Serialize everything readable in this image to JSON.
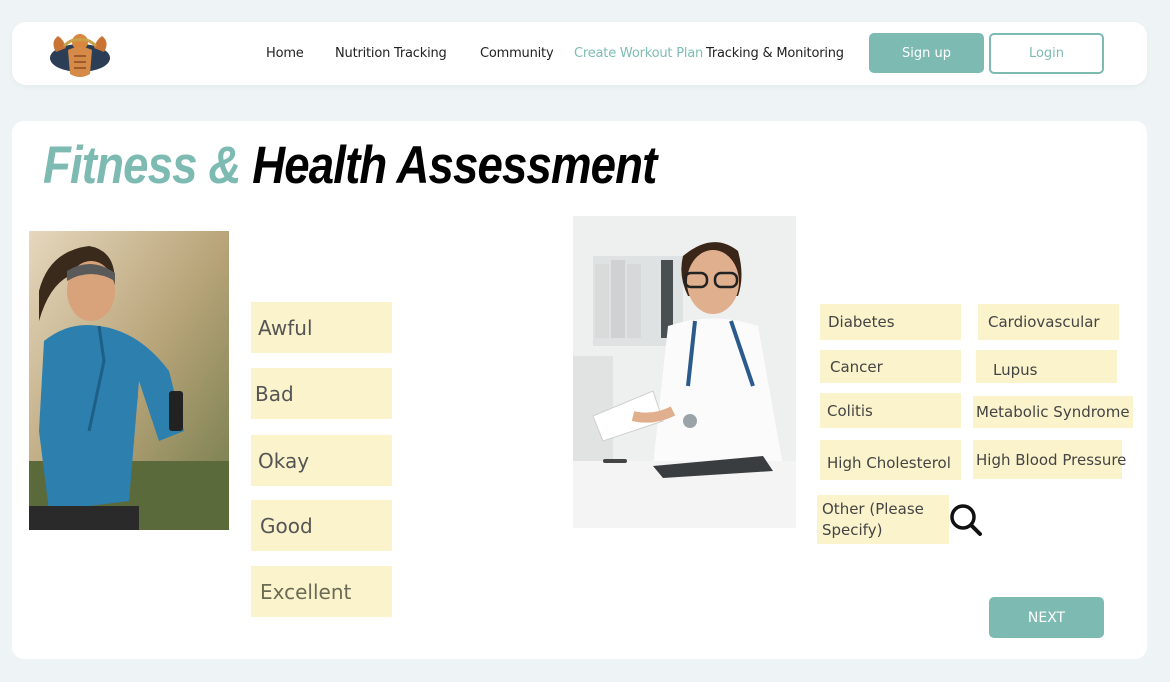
{
  "nav": {
    "logo_icon": "bodybuilder-logo-icon",
    "links": [
      "Home",
      "Nutrition Tracking",
      "Community",
      "Create Workout Plan",
      "Tracking & Monitoring"
    ],
    "active_link": "Create Workout Plan",
    "signup_label": "Sign up",
    "login_label": "Login"
  },
  "page": {
    "title_part1": "Fitness &",
    "title_part2": "Health Assessment",
    "runner_image": "woman-jogging-photo",
    "doctor_image": "doctor-handing-paper-photo"
  },
  "ratings": [
    "Awful",
    "Bad",
    "Okay",
    "Good",
    "Excellent"
  ],
  "conditions": [
    "Diabetes",
    "Cardiovascular",
    "Cancer",
    "Lupus",
    "Colitis",
    "Metabolic Syndrome",
    "High Cholesterol",
    "High Blood Pressure",
    "Other (Please Specify)"
  ],
  "search_icon": "search-icon",
  "next_label": "NEXT",
  "colors": {
    "accent": "#7dbab2",
    "option_bg": "#faf3cb",
    "page_bg": "#eef4f5"
  }
}
